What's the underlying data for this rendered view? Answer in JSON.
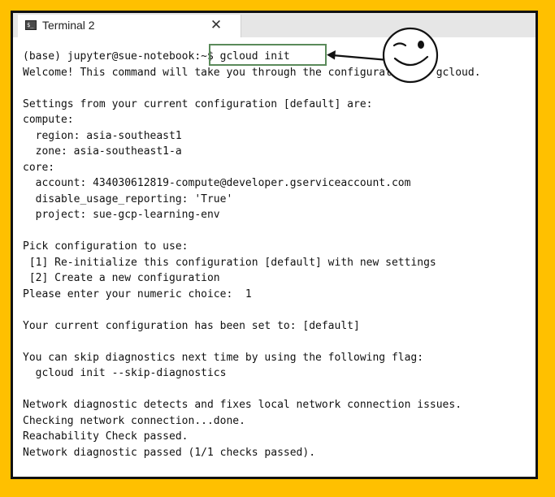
{
  "window": {
    "tab_title": "Terminal 2",
    "tab_icon_glyph": "$_",
    "close_glyph": "✕"
  },
  "terminal": {
    "lines": [
      "(base) jupyter@sue-notebook:~$ gcloud init",
      "Welcome! This command will take you through the configuration of gcloud.",
      "",
      "Settings from your current configuration [default] are:",
      "compute:",
      "  region: asia-southeast1",
      "  zone: asia-southeast1-a",
      "core:",
      "  account: 434030612819-compute@developer.gserviceaccount.com",
      "  disable_usage_reporting: 'True'",
      "  project: sue-gcp-learning-env",
      "",
      "Pick configuration to use:",
      " [1] Re-initialize this configuration [default] with new settings",
      " [2] Create a new configuration",
      "Please enter your numeric choice:  1",
      "",
      "Your current configuration has been set to: [default]",
      "",
      "You can skip diagnostics next time by using the following flag:",
      "  gcloud init --skip-diagnostics",
      "",
      "Network diagnostic detects and fixes local network connection issues.",
      "Checking network connection...done.",
      "Reachability Check passed.",
      "Network diagnostic passed (1/1 checks passed)."
    ]
  },
  "annotation": {
    "icon": "winking-smiley-icon",
    "arrow_icon": "arrow-left-icon",
    "highlight": "gcloud-init-highlight-box"
  },
  "colors": {
    "background": "#FFC000",
    "frame_border": "#111111",
    "titlebar": "#e6e6e6",
    "terminal_text": "#111111",
    "highlight_border": "#5a8a5a"
  }
}
